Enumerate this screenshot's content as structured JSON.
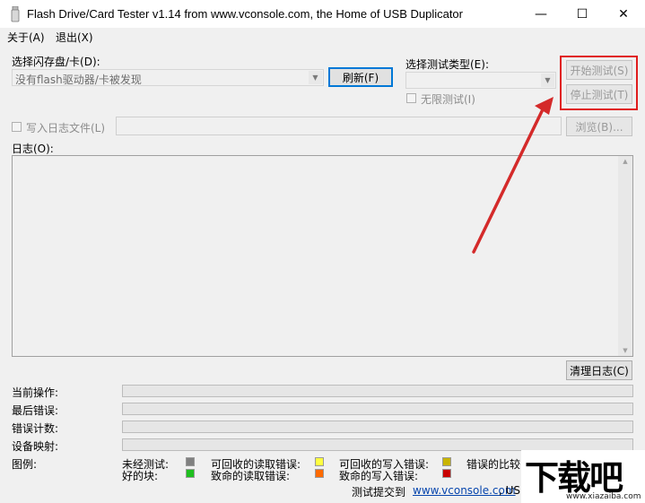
{
  "window": {
    "title": "Flash Drive/Card Tester v1.14 from www.vconsole.com, the Home of USB Duplicator",
    "minimize": "—",
    "maximize": "☐",
    "close": "✕"
  },
  "menu": {
    "about": "关于(A)",
    "exit": "退出(X)"
  },
  "drive": {
    "label": "选择闪存盘/卡(D):",
    "value": "没有flash驱动器/卡被发现",
    "refresh": "刷新(F)"
  },
  "test_type": {
    "label": "选择测试类型(E):",
    "value": "",
    "infinite": "无限测试(I)"
  },
  "actions": {
    "start": "开始测试(S)",
    "stop": "停止测试(T)"
  },
  "logfile": {
    "label": "写入日志文件(L)",
    "browse": "浏览(B)..."
  },
  "log": {
    "label": "日志(O):",
    "clear": "清理日志(C)"
  },
  "status": {
    "current_op": "当前操作:",
    "last_error": "最后错误:",
    "error_count": "错误计数:",
    "device_map": "设备映射:"
  },
  "legend": {
    "label": "图例:",
    "items": [
      {
        "label": "未经测试:",
        "color": "#808080"
      },
      {
        "label": "好的块:",
        "color": "#1fbf1f"
      },
      {
        "label": "可回收的读取错误:",
        "color": "#ffff40"
      },
      {
        "label": "致命的读取错误:",
        "color": "#ff6a00"
      },
      {
        "label": "可回收的写入错误:",
        "color": "#c8b400"
      },
      {
        "label": "致命的写入错误:",
        "color": "#c80000"
      },
      {
        "label": "错误的比较",
        "color": ""
      }
    ]
  },
  "footer": {
    "submit": "测试提交到",
    "link": "www.vconsole.com",
    "tail": ", US"
  },
  "watermark": {
    "big": "下载吧",
    "small": "www.xiazaiba.com"
  },
  "colors": {
    "highlight": "#e01c1c",
    "arrow": "#d42a2a"
  }
}
